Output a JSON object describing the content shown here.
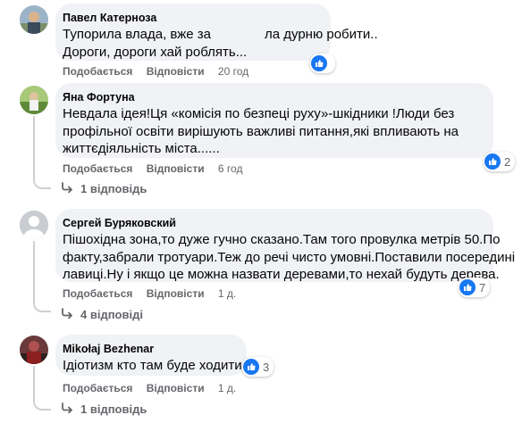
{
  "comments": [
    {
      "author": "Павел Катерноза",
      "lines": [
        "Тупорила влада, вже за",
        "ла дурню робити..",
        "Дороги, дороги хай роблять..."
      ],
      "like_label": "Подобається",
      "reply_label": "Відповісти",
      "time": "20 год",
      "reaction_icon": "like-icon",
      "reaction_count": ""
    },
    {
      "author": "Яна Фортуна",
      "lines": [
        "Невдала ідея!Ця «комісія по безпеці руху»-шкідники !Люди без",
        "профільної освіти вирішують важливі питання,які впливають на",
        "життєдіяльність міста......"
      ],
      "like_label": "Подобається",
      "reply_label": "Відповісти",
      "time": "6 год",
      "reaction_icon": "like-icon",
      "reaction_count": "2",
      "replies_label": "1 відповідь"
    },
    {
      "author": "Сергей Буряковский",
      "lines": [
        "Пішохідна зона,то дуже гучно сказано.Там того провулка метрів 50.По",
        "факту,забрали тротуари.Теж до речі чисто умовні.Поставили посередині",
        "лавиці.Ну і якщо це можна назвати деревами,то нехай будуть дерева."
      ],
      "like_label": "Подобається",
      "reply_label": "Відповісти",
      "time": "1 д.",
      "reaction_icon": "like-icon",
      "reaction_count": "7",
      "replies_label": "4 відповіді"
    },
    {
      "author": "Mikołaj Bezhenar",
      "lines": [
        "Ідіотизм кто там буде ходити ?"
      ],
      "like_label": "Подобається",
      "reply_label": "Відповісти",
      "time": "1 д.",
      "reaction_icon": "like-icon",
      "reaction_count": "3",
      "replies_label": "1 відповідь"
    }
  ],
  "colors": {
    "bubble": "#f0f2f5",
    "meta_text": "#65676b",
    "like_blue": "#1877f2",
    "thread_line": "#ced0d4"
  }
}
